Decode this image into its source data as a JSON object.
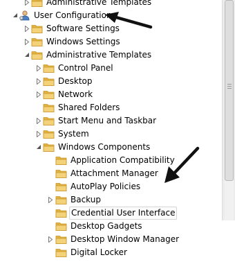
{
  "tree": {
    "items": [
      {
        "label": "Administrative Templates",
        "level": 1,
        "expander": "collapsed",
        "icon": "folder-icon"
      },
      {
        "label": "User Configuration",
        "level": 0,
        "expander": "expanded",
        "icon": "user-config-icon"
      },
      {
        "label": "Software Settings",
        "level": 1,
        "expander": "collapsed",
        "icon": "folder-icon"
      },
      {
        "label": "Windows Settings",
        "level": 1,
        "expander": "collapsed",
        "icon": "folder-icon"
      },
      {
        "label": "Administrative Templates",
        "level": 1,
        "expander": "expanded",
        "icon": "folder-icon"
      },
      {
        "label": "Control Panel",
        "level": 2,
        "expander": "collapsed",
        "icon": "folder-icon"
      },
      {
        "label": "Desktop",
        "level": 2,
        "expander": "collapsed",
        "icon": "folder-icon"
      },
      {
        "label": "Network",
        "level": 2,
        "expander": "collapsed",
        "icon": "folder-icon"
      },
      {
        "label": "Shared Folders",
        "level": 2,
        "expander": "none",
        "icon": "folder-icon"
      },
      {
        "label": "Start Menu and Taskbar",
        "level": 2,
        "expander": "collapsed",
        "icon": "folder-icon"
      },
      {
        "label": "System",
        "level": 2,
        "expander": "collapsed",
        "icon": "folder-icon"
      },
      {
        "label": "Windows Components",
        "level": 2,
        "expander": "expanded",
        "icon": "folder-icon"
      },
      {
        "label": "Application Compatibility",
        "level": 3,
        "expander": "none",
        "icon": "folder-icon"
      },
      {
        "label": "Attachment Manager",
        "level": 3,
        "expander": "none",
        "icon": "folder-icon"
      },
      {
        "label": "AutoPlay Policies",
        "level": 3,
        "expander": "none",
        "icon": "folder-icon"
      },
      {
        "label": "Backup",
        "level": 3,
        "expander": "collapsed",
        "icon": "folder-icon"
      },
      {
        "label": "Credential User Interface",
        "level": 3,
        "expander": "none",
        "icon": "folder-icon",
        "selected": true
      },
      {
        "label": "Desktop Gadgets",
        "level": 3,
        "expander": "none",
        "icon": "folder-icon"
      },
      {
        "label": "Desktop Window Manager",
        "level": 3,
        "expander": "collapsed",
        "icon": "folder-icon"
      },
      {
        "label": "Digital Locker",
        "level": 3,
        "expander": "none",
        "icon": "folder-icon"
      }
    ]
  },
  "colors": {
    "folder_front": "#f3d27a",
    "folder_back": "#e2b23f",
    "folder_edge": "#c8962c",
    "expander": "#7a7a7a",
    "selection_bg": "#fbfbfb",
    "selection_border": "#d6d6d6",
    "annotation_arrow": "#111111"
  },
  "scrollbar": {
    "thumb_position_fraction": 0.0,
    "visible_fraction": 0.82
  }
}
